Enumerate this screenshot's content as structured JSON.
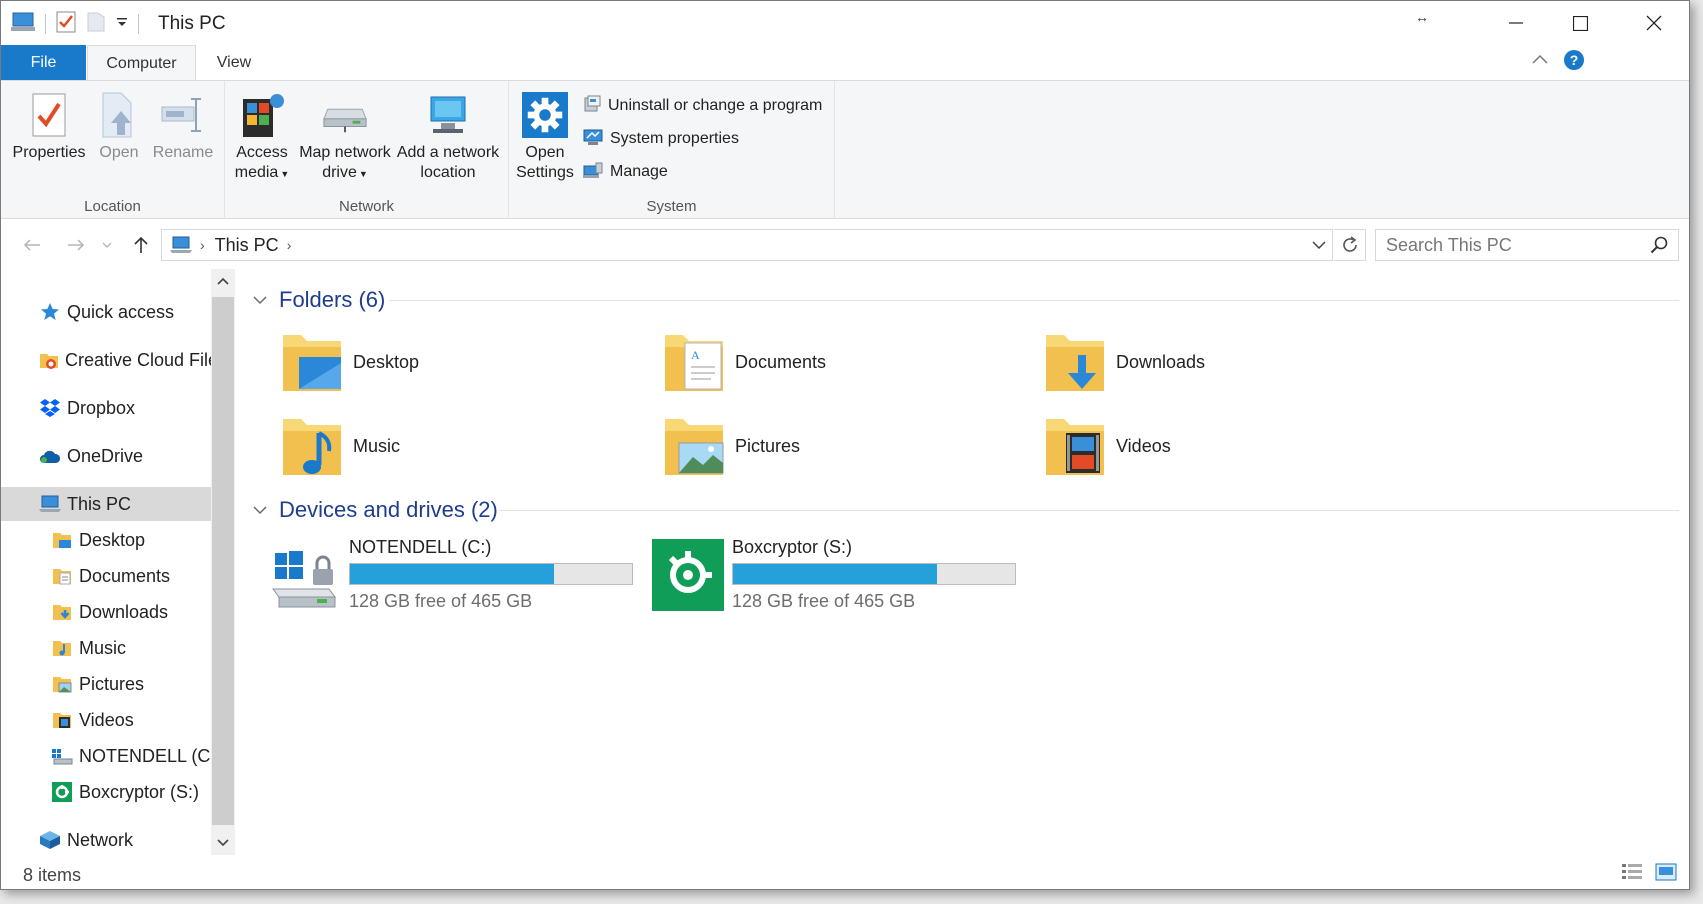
{
  "window": {
    "title": "This PC"
  },
  "ribbon": {
    "tabs": [
      {
        "label": "File"
      },
      {
        "label": "Computer"
      },
      {
        "label": "View"
      }
    ],
    "groups": {
      "location": {
        "label": "Location",
        "buttons": [
          {
            "label": "Properties"
          },
          {
            "label": "Open"
          },
          {
            "label": "Rename"
          }
        ]
      },
      "network": {
        "label": "Network",
        "buttons": [
          {
            "line1": "Access",
            "line2": "media"
          },
          {
            "line1": "Map network",
            "line2": "drive"
          },
          {
            "line1": "Add a network",
            "line2": "location"
          }
        ]
      },
      "system": {
        "label": "System",
        "open_settings": {
          "line1": "Open",
          "line2": "Settings"
        },
        "small": [
          {
            "label": "Uninstall or change a program"
          },
          {
            "label": "System properties"
          },
          {
            "label": "Manage"
          }
        ]
      }
    }
  },
  "address": {
    "crumb": "This PC",
    "search_placeholder": "Search This PC"
  },
  "nav_pane": {
    "items": [
      {
        "label": "Quick access"
      },
      {
        "label": "Creative Cloud Files"
      },
      {
        "label": "Dropbox"
      },
      {
        "label": "OneDrive"
      },
      {
        "label": "This PC"
      },
      {
        "label": "Desktop"
      },
      {
        "label": "Documents"
      },
      {
        "label": "Downloads"
      },
      {
        "label": "Music"
      },
      {
        "label": "Pictures"
      },
      {
        "label": "Videos"
      },
      {
        "label": "NOTENDELL (C:)"
      },
      {
        "label": "Boxcryptor (S:)"
      },
      {
        "label": "Network"
      }
    ]
  },
  "content": {
    "folders_header": "Folders (6)",
    "folders": [
      {
        "name": "Desktop"
      },
      {
        "name": "Documents"
      },
      {
        "name": "Downloads"
      },
      {
        "name": "Music"
      },
      {
        "name": "Pictures"
      },
      {
        "name": "Videos"
      }
    ],
    "drives_header": "Devices and drives (2)",
    "drives": [
      {
        "name": "NOTENDELL (C:)",
        "free": "128 GB free of 465 GB",
        "used_fraction": 0.725
      },
      {
        "name": "Boxcryptor (S:)",
        "free": "128 GB free of 465 GB",
        "used_fraction": 0.725
      }
    ]
  },
  "status": {
    "items": "8 items"
  },
  "colors": {
    "accent": "#1979ca",
    "drive_bar": "#26a0da",
    "header_text": "#1e3d8f",
    "boxcryptor": "#0f9d58"
  }
}
